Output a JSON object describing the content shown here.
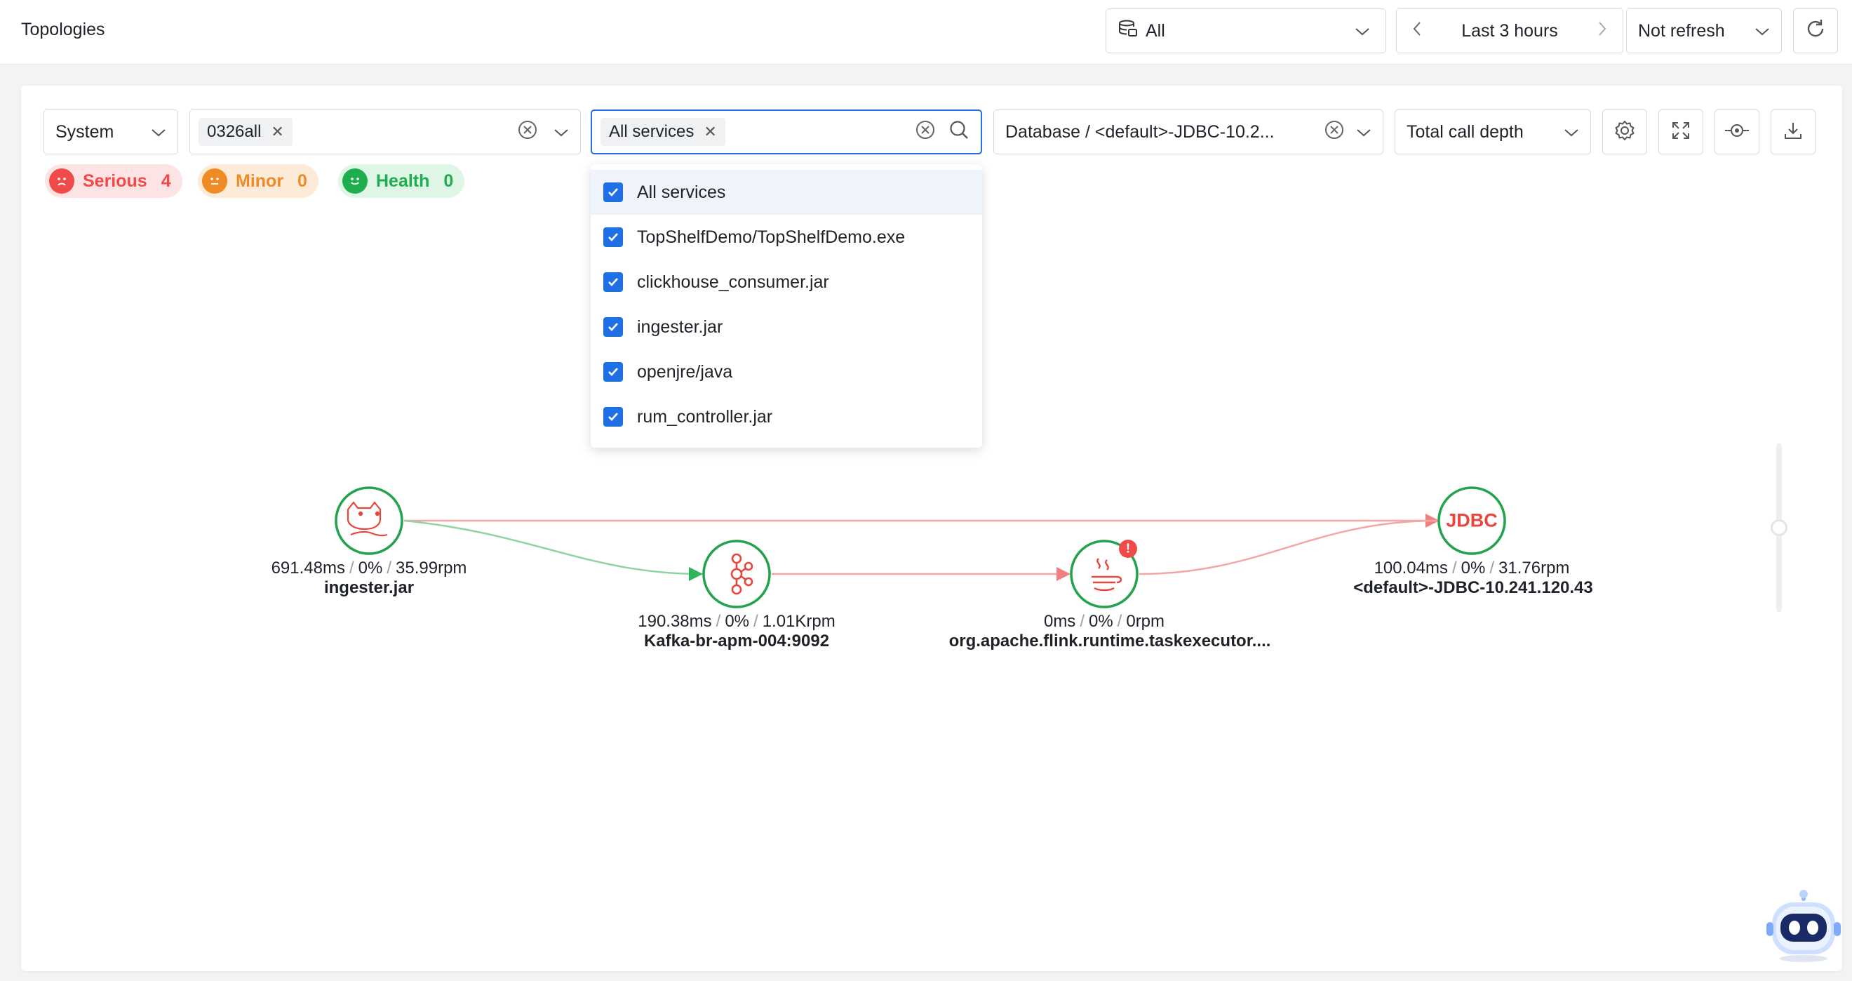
{
  "header": {
    "title": "Topologies",
    "env_select": "All",
    "time_range": "Last 3 hours",
    "refresh_select": "Not refresh"
  },
  "filters": {
    "system_select": "System",
    "system_tag": "0326all",
    "service_tag": "All services",
    "database_select": "Database / <default>-JDBC-10.2...",
    "depth_select": "Total call depth"
  },
  "status": {
    "serious": {
      "label": "Serious",
      "count": "4",
      "color": "#f04a4a"
    },
    "minor": {
      "label": "Minor",
      "count": "0",
      "color": "#f08a24"
    },
    "health": {
      "label": "Health",
      "count": "0",
      "color": "#1fae4f"
    }
  },
  "dropdown": {
    "options": [
      {
        "label": "All services",
        "checked": true
      },
      {
        "label": "TopShelfDemo/TopShelfDemo.exe",
        "checked": true
      },
      {
        "label": "clickhouse_consumer.jar",
        "checked": true
      },
      {
        "label": "ingester.jar",
        "checked": true
      },
      {
        "label": "openjre/java",
        "checked": true
      },
      {
        "label": "rum_controller.jar",
        "checked": true
      }
    ]
  },
  "nodes": [
    {
      "name": "ingester.jar",
      "latency": "691.48ms",
      "error": "0%",
      "rate": "35.99rpm",
      "icon": "tomcat-icon"
    },
    {
      "name": "Kafka-br-apm-004:9092",
      "latency": "190.38ms",
      "error": "0%",
      "rate": "1.01Krpm",
      "icon": "kafka-icon"
    },
    {
      "name": "org.apache.flink.runtime.taskexecutor....",
      "latency": "0ms",
      "error": "0%",
      "rate": "0rpm",
      "icon": "java-icon",
      "alert": "!"
    },
    {
      "name": "<default>-JDBC-10.241.120.43",
      "latency": "100.04ms",
      "error": "0%",
      "rate": "31.76rpm",
      "icon": "jdbc-icon",
      "icon_text": "JDBC"
    }
  ],
  "colors": {
    "accent": "#1f6fe5",
    "node_border": "#22a24a",
    "node_icon": "#e8453c",
    "edge_red": "#f3a6a6",
    "edge_green": "#8fd4a3"
  }
}
